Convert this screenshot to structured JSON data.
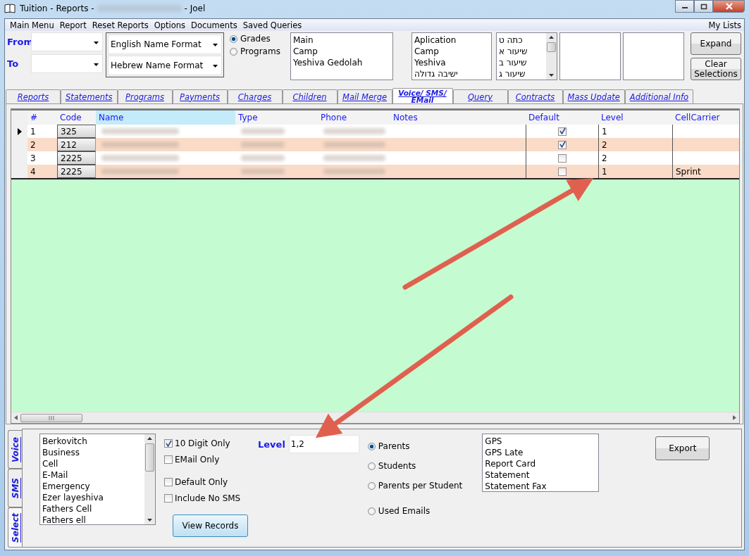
{
  "window": {
    "title_start": "Tuition - Reports -",
    "title_end": "- Joel"
  },
  "menu": [
    "Main Menu",
    "Report",
    "Reset Reports",
    "Options",
    "Documents",
    "Saved Queries"
  ],
  "menu_right": "My Lists",
  "date_range": {
    "from_label": "From",
    "to_label": "To"
  },
  "name_formats": [
    "English Name Format",
    "Hebrew Name Format"
  ],
  "group_by": [
    {
      "label": "Grades",
      "selected": true
    },
    {
      "label": "Programs",
      "selected": false
    }
  ],
  "lists": [
    {
      "items": [
        "Main",
        "Camp",
        "Yeshiva Gedolah"
      ],
      "scrollbar": false
    },
    {
      "items": [
        "Aplication",
        "Camp",
        "Yeshiva",
        "ישיבה גדולה"
      ],
      "scrollbar": false
    },
    {
      "items": [
        "כתה ט",
        "שיעור א",
        "שיעור ב",
        "שיעור ג"
      ],
      "scrollbar": true
    }
  ],
  "side_buttons": [
    "Expand",
    "Clear Selections"
  ],
  "tabs": [
    {
      "label": "Reports",
      "selected": false
    },
    {
      "label": "Statements",
      "selected": false
    },
    {
      "label": "Programs",
      "selected": false
    },
    {
      "label": "Payments",
      "selected": false
    },
    {
      "label": "Charges",
      "selected": false
    },
    {
      "label": "Children",
      "selected": false
    },
    {
      "label": "Mail Merge",
      "selected": false
    },
    {
      "label": "Voice/ SMS/ EMail",
      "selected": true
    },
    {
      "label": "Query",
      "selected": false
    },
    {
      "label": "Contracts",
      "selected": false
    },
    {
      "label": "Mass Update",
      "selected": false
    },
    {
      "label": "Additional Info",
      "selected": false
    }
  ],
  "grid": {
    "columns": [
      "#",
      "Code",
      "Name",
      "Type",
      "Phone",
      "Notes",
      "Default",
      "Level",
      "CellCarrier"
    ],
    "rows": [
      {
        "num": "1",
        "code": "325",
        "default": true,
        "level": "1",
        "cell_carrier": "",
        "current": true
      },
      {
        "num": "2",
        "code": "212",
        "default": true,
        "level": "2",
        "cell_carrier": "",
        "current": false
      },
      {
        "num": "3",
        "code": "2225",
        "default": false,
        "level": "2",
        "cell_carrier": "",
        "current": false
      },
      {
        "num": "4",
        "code": "2225",
        "default": false,
        "level": "1",
        "cell_carrier": "Sprint",
        "current": false
      }
    ]
  },
  "side_tabs": [
    {
      "label": "Voice",
      "selected": false
    },
    {
      "label": "SMS",
      "selected": false
    },
    {
      "label": "Select",
      "selected": true
    }
  ],
  "phone_types": [
    "Berkovitch",
    "Business",
    "Cell",
    "E-Mail",
    "Emergency",
    "Ezer layeshiva",
    "Fathers Cell",
    "Fathers ell"
  ],
  "filters": [
    {
      "label": "10 Digit Only",
      "checked": true
    },
    {
      "label": "EMail Only",
      "checked": false
    },
    {
      "label": "Default Only",
      "checked": false
    },
    {
      "label": "Include No SMS",
      "checked": false
    }
  ],
  "level_filter": {
    "label": "Level",
    "value": "1,2"
  },
  "recipients": [
    {
      "label": "Parents",
      "selected": true
    },
    {
      "label": "Students",
      "selected": false
    },
    {
      "label": "Parents per Student",
      "selected": false
    },
    {
      "label": "Used Emails",
      "selected": false
    }
  ],
  "report_types": [
    "GPS",
    "GPS Late",
    "Report Card",
    "Statement",
    "Statement Fax"
  ],
  "view_button": "View Records",
  "export_button": "Export"
}
